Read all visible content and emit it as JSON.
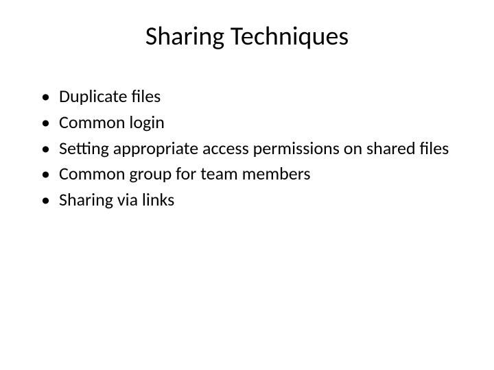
{
  "slide": {
    "title": "Sharing Techniques",
    "bullets": [
      "Duplicate files",
      "Common login",
      "Setting appropriate access permissions on shared files",
      "Common group for team members",
      "Sharing via links"
    ]
  }
}
